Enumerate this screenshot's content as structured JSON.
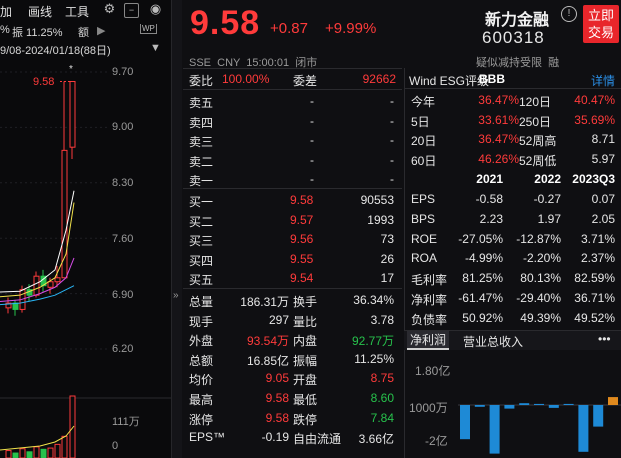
{
  "toolbar": {
    "items": [
      "加",
      "画线",
      "工具"
    ],
    "pct_text": "%",
    "amplitude": "振 11.25%",
    "amount": "额",
    "wp": "WP"
  },
  "chart": {
    "range_label": "9/08-2024/01/18(88日)",
    "price_ticks": [
      "9.70",
      "9.00",
      "8.30",
      "7.60",
      "6.90",
      "6.20"
    ],
    "vol_ticks": [
      "111万",
      "0"
    ],
    "current_price_label": "9.58",
    "star": "*",
    "colors": {
      "up": "#ff3b3b",
      "down": "#27c24c",
      "ma1": "#ffffff",
      "ma2": "#f2e34b",
      "ma3": "#d64ce8",
      "ma4": "#29b6f6"
    }
  },
  "header": {
    "price": "9.58",
    "change": "+0.87",
    "change_pct": "+9.99%",
    "name": "新力金融",
    "code": "600318",
    "info": "!",
    "trade_button": [
      "立即",
      "交易"
    ],
    "meta": "SSE  CNY  15:00:01  闭市",
    "flags": "疑似减持受限  融"
  },
  "orderbook": {
    "weibi_label": "委比",
    "weibi_val": "100.00%",
    "weicha_label": "委差",
    "weicha_val": "92662",
    "asks": [
      {
        "label": "卖五",
        "price": "-",
        "vol": "-"
      },
      {
        "label": "卖四",
        "price": "-",
        "vol": "-"
      },
      {
        "label": "卖三",
        "price": "-",
        "vol": "-"
      },
      {
        "label": "卖二",
        "price": "-",
        "vol": "-"
      },
      {
        "label": "卖一",
        "price": "-",
        "vol": "-"
      }
    ],
    "bids": [
      {
        "label": "买一",
        "price": "9.58",
        "vol": "90553"
      },
      {
        "label": "买二",
        "price": "9.57",
        "vol": "1993"
      },
      {
        "label": "买三",
        "price": "9.56",
        "vol": "73"
      },
      {
        "label": "买四",
        "price": "9.55",
        "vol": "26"
      },
      {
        "label": "买五",
        "price": "9.54",
        "vol": "17"
      }
    ]
  },
  "stats": [
    {
      "l1": "总量",
      "v1": "186.31万",
      "c1": "white",
      "l2": "换手",
      "v2": "36.34%",
      "c2": "white"
    },
    {
      "l1": "现手",
      "v1": "297",
      "c1": "white",
      "l2": "量比",
      "v2": "3.78",
      "c2": "white"
    },
    {
      "l1": "外盘",
      "v1": "93.54万",
      "c1": "red",
      "l2": "内盘",
      "v2": "92.77万",
      "c2": "green"
    },
    {
      "l1": "总额",
      "v1": "16.85亿",
      "c1": "white",
      "l2": "振幅",
      "v2": "11.25%",
      "c2": "white"
    },
    {
      "l1": "均价",
      "v1": "9.05",
      "c1": "red",
      "l2": "开盘",
      "v2": "8.75",
      "c2": "red"
    },
    {
      "l1": "最高",
      "v1": "9.58",
      "c1": "red",
      "l2": "最低",
      "v2": "8.60",
      "c2": "green"
    },
    {
      "l1": "涨停",
      "v1": "9.58",
      "c1": "red",
      "l2": "跌停",
      "v2": "7.84",
      "c2": "green"
    },
    {
      "l1": "EPS™",
      "v1": "-0.19",
      "c1": "white",
      "l2": "自由流通",
      "v2": "3.66亿",
      "c2": "white"
    }
  ],
  "esg": {
    "label": "Wind ESG评级",
    "rating": "BBB",
    "detail": "详情"
  },
  "performance": [
    {
      "l1": "今年",
      "v1": "36.47%",
      "l2": "120日",
      "v2": "40.47%",
      "c2": "red"
    },
    {
      "l1": "5日",
      "v1": "33.61%",
      "l2": "250日",
      "v2": "35.69%",
      "c2": "red"
    },
    {
      "l1": "20日",
      "v1": "36.47%",
      "l2": "52周高",
      "v2": "8.71",
      "c2": "white"
    },
    {
      "l1": "60日",
      "v1": "46.26%",
      "l2": "52周低",
      "v2": "5.97",
      "c2": "white"
    }
  ],
  "fin_headers": [
    "2021",
    "2022",
    "2023Q3"
  ],
  "fin_rows": [
    {
      "label": "EPS",
      "vals": [
        "-0.58",
        "-0.27",
        "0.07"
      ]
    },
    {
      "label": "BPS",
      "vals": [
        "2.23",
        "1.97",
        "2.05"
      ]
    },
    {
      "label": "ROE",
      "vals": [
        "-27.05%",
        "-12.87%",
        "3.71%"
      ]
    },
    {
      "label": "ROA",
      "vals": [
        "-4.99%",
        "-2.20%",
        "2.37%"
      ]
    },
    {
      "label": "毛利率",
      "vals": [
        "81.25%",
        "80.13%",
        "82.59%"
      ]
    },
    {
      "label": "净利率",
      "vals": [
        "-61.47%",
        "-29.40%",
        "36.71%"
      ]
    },
    {
      "label": "负债率",
      "vals": [
        "50.92%",
        "49.39%",
        "49.52%"
      ]
    }
  ],
  "tabs": {
    "t1": "净利润",
    "t2": "营业总收入",
    "more": "•••"
  },
  "mini_chart": {
    "yticks": [
      "1.80亿",
      "1000万",
      "-2亿"
    ],
    "bars": [
      {
        "value": -0.95,
        "color": "#1e8ad6"
      },
      {
        "value": -0.05,
        "color": "#1e8ad6"
      },
      {
        "value": -1.35,
        "color": "#1e8ad6"
      },
      {
        "value": -0.1,
        "color": "#1e8ad6"
      },
      {
        "value": 0.05,
        "color": "#1e8ad6"
      },
      {
        "value": 0.03,
        "color": "#1e8ad6"
      },
      {
        "value": -0.08,
        "color": "#1e8ad6"
      },
      {
        "value": 0.03,
        "color": "#1e8ad6"
      },
      {
        "value": -1.3,
        "color": "#1e8ad6"
      },
      {
        "value": -0.6,
        "color": "#1e8ad6"
      },
      {
        "value": 0.22,
        "color": "#e08a1e"
      }
    ]
  }
}
